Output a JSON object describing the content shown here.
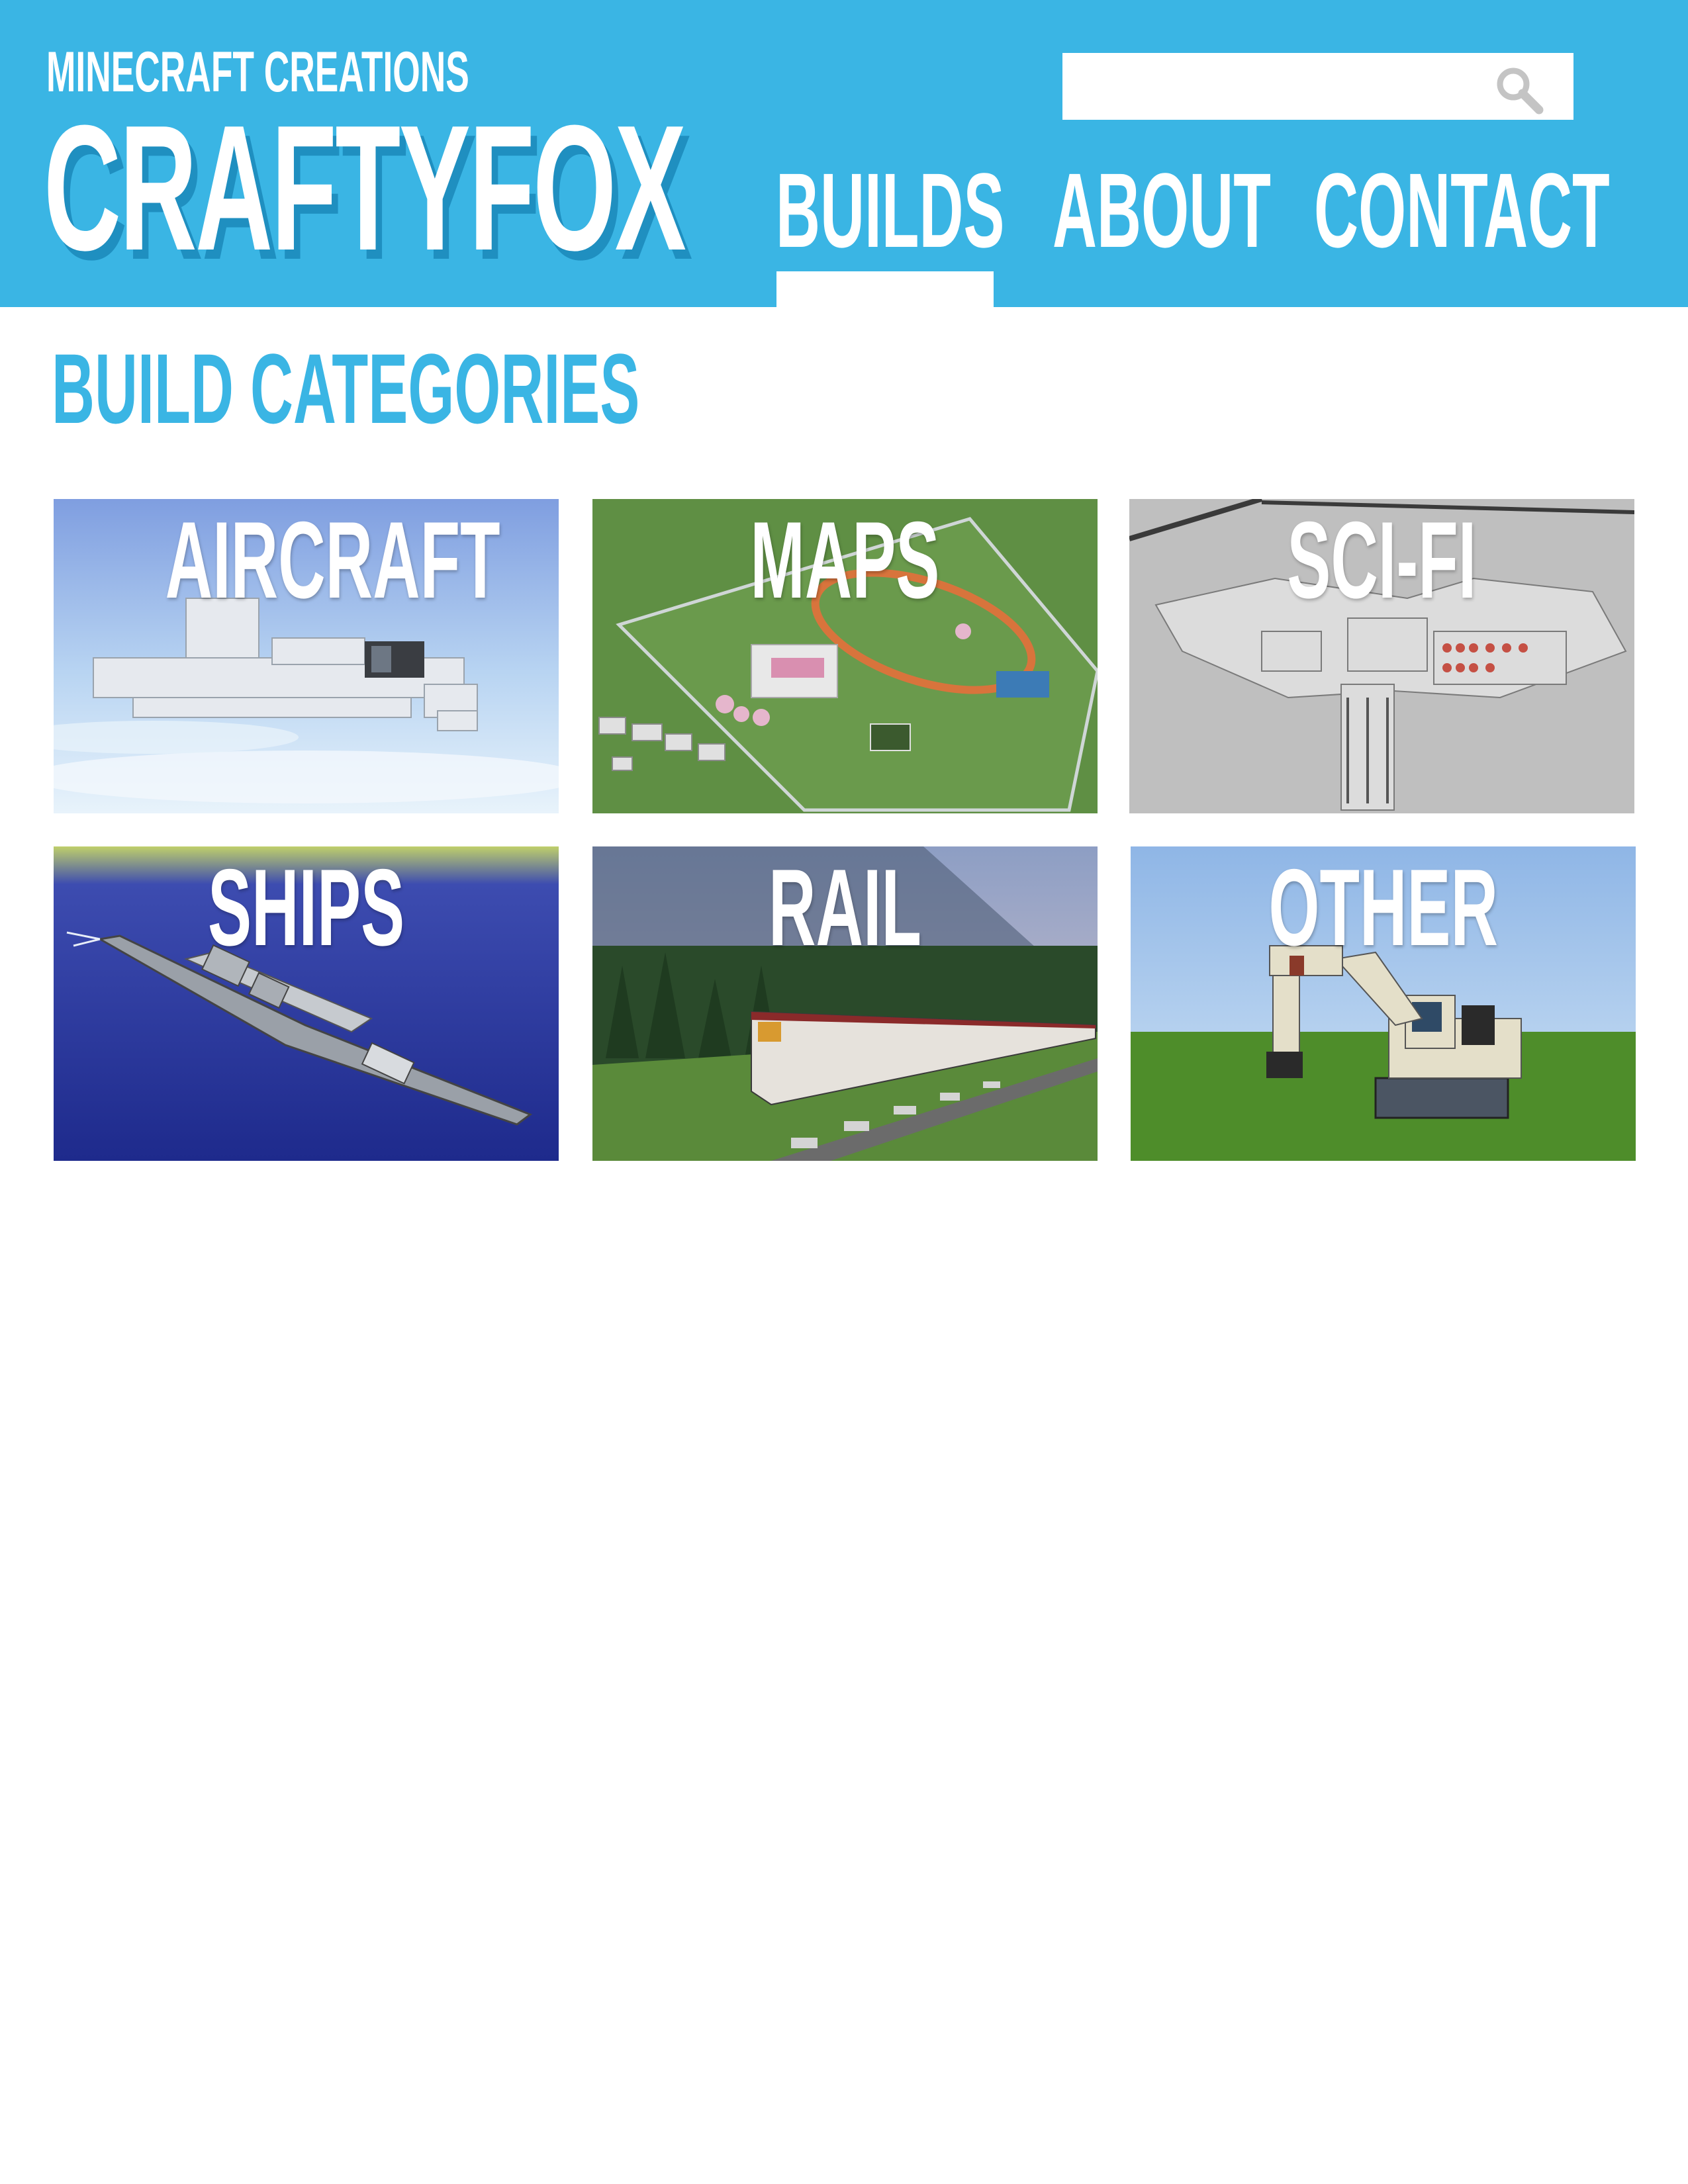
{
  "header": {
    "tagline": "MINECRAFT CREATIONS",
    "brand": "CRAFTYFOX",
    "background_color": "#3ab5e4",
    "search": {
      "placeholder": "",
      "icon": "search-icon"
    },
    "nav": [
      {
        "label": "BUILDS",
        "active": true
      },
      {
        "label": "ABOUT",
        "active": false
      },
      {
        "label": "CONTACT",
        "active": false
      }
    ]
  },
  "main": {
    "section_title": "BUILD CATEGORIES",
    "categories": [
      {
        "label": "AIRCRAFT",
        "image": "minecraft-aircraft-build"
      },
      {
        "label": "MAPS",
        "image": "minecraft-map-build"
      },
      {
        "label": "SCI-FI",
        "image": "minecraft-scifi-build"
      },
      {
        "label": "SHIPS",
        "image": "minecraft-ship-build"
      },
      {
        "label": "RAIL",
        "image": "minecraft-train-build"
      },
      {
        "label": "OTHER",
        "image": "minecraft-excavator-build"
      }
    ]
  }
}
